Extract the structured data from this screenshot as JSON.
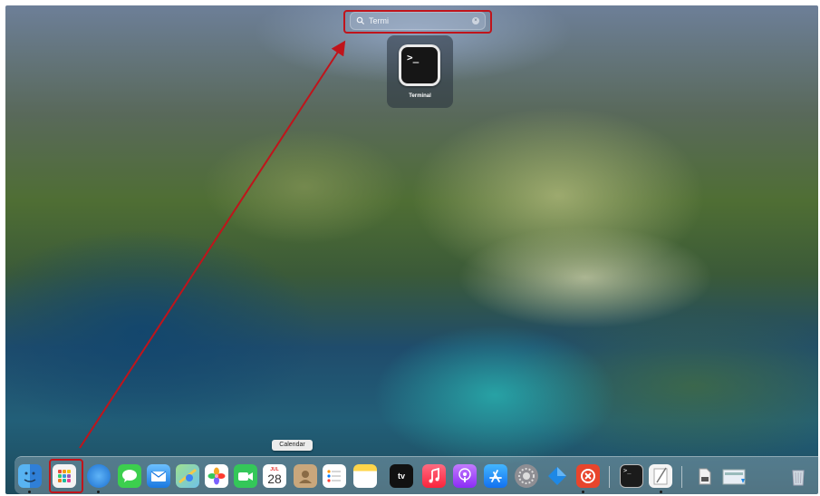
{
  "search": {
    "query": "Termi"
  },
  "result": {
    "label": "Terminal",
    "icon_prompt": ">_"
  },
  "tooltip": {
    "label": "Calendar"
  },
  "calendar": {
    "month": "JUL",
    "day": "28"
  },
  "tv": {
    "label": "tv"
  },
  "colors": {
    "highlight": "#c0141b",
    "arrow": "#c0141b"
  },
  "dock": {
    "items": [
      {
        "name": "finder-icon"
      },
      {
        "name": "launchpad-icon"
      },
      {
        "name": "safari-icon"
      },
      {
        "name": "messages-icon"
      },
      {
        "name": "mail-icon"
      },
      {
        "name": "maps-icon"
      },
      {
        "name": "photos-icon"
      },
      {
        "name": "facetime-icon"
      },
      {
        "name": "calendar-icon"
      },
      {
        "name": "contacts-icon"
      },
      {
        "name": "reminders-icon"
      },
      {
        "name": "notes-icon"
      },
      {
        "name": "apple-tv-icon"
      },
      {
        "name": "music-icon"
      },
      {
        "name": "podcasts-icon"
      },
      {
        "name": "app-store-icon"
      },
      {
        "name": "system-preferences-icon"
      },
      {
        "name": "xcode-like-blue-app-icon"
      },
      {
        "name": "remote-desktop-icon"
      },
      {
        "name": "terminal-icon"
      },
      {
        "name": "textedit-icon"
      },
      {
        "name": "document-icon"
      },
      {
        "name": "downloads-stack-icon"
      },
      {
        "name": "trash-icon"
      }
    ]
  }
}
